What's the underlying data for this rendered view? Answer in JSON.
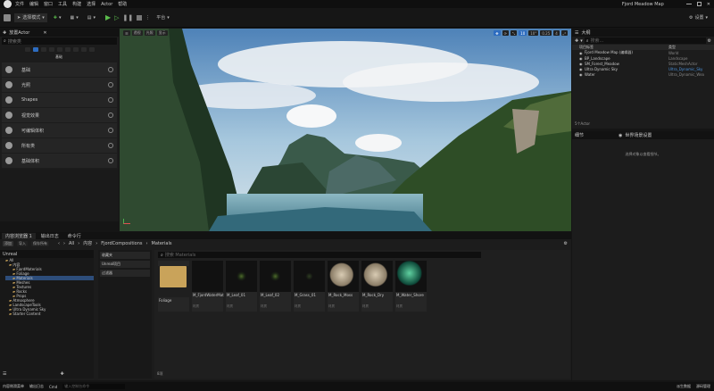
{
  "window": {
    "menu": [
      "文件",
      "编辑",
      "窗口",
      "工具",
      "构建",
      "选择",
      "Actor",
      "帮助"
    ],
    "project": "Fjord Meadow Map",
    "tab": "LostVille"
  },
  "toolbar": {
    "mode": "选择模式",
    "platforms": "平台",
    "settings": "设置"
  },
  "place": {
    "title": "放置Actor",
    "search": "搜索类",
    "items": [
      "基础",
      "光照",
      "Shapes",
      "视觉效果",
      "可编辑体积",
      "所有类",
      "基础体积"
    ]
  },
  "viewport": {
    "left": [
      "透视",
      "光照",
      "显示"
    ],
    "right": [
      "10",
      "10°",
      "0.25",
      "4"
    ]
  },
  "outliner": {
    "title": "大纲",
    "search": "搜索...",
    "col1": "项目标签",
    "col2": "类型",
    "rows": [
      {
        "label": "Fjord Meadow Map (编辑器)",
        "type": "World"
      },
      {
        "label": "BP_Landscape",
        "type": "Landscape"
      },
      {
        "label": "SM_Forest_Meadow",
        "type": "StaticMeshActor"
      },
      {
        "label": "Ultra Dynamic Sky",
        "type": "Ultra_Dynamic_Sky"
      },
      {
        "label": "Water",
        "type": "Ultra_Dynamic_Wea"
      }
    ],
    "count": "5个Actor"
  },
  "details": {
    "tab1": "细节",
    "tab2": "世界场景设置",
    "empty": "选择对象以查看细节。"
  },
  "bottom_tabs": [
    "内容浏览器 1",
    "输出日志",
    "命令行"
  ],
  "content": {
    "buttons": [
      "添加",
      "导入",
      "保存所有"
    ],
    "path": [
      "All",
      "内容",
      "FjordCompositions",
      "Materials"
    ],
    "search": "搜索 Materials",
    "tree_root": "Unreal",
    "tree": [
      "All",
      "内容",
      "FjordMaterials",
      "Foliage",
      "Materials",
      "Meshes",
      "Textures",
      "Rocks",
      "Props",
      "Atmosphere",
      "LandscapeTools",
      "Ultra Dynamic Sky",
      "Starter Content"
    ],
    "filters": [
      "收藏夹",
      "Unreal项目",
      "过滤器"
    ],
    "assets": [
      {
        "name": "Foliage",
        "type": ""
      },
      {
        "name": "M_FjordWaterMat",
        "type": "材质"
      },
      {
        "name": "M_Leaf_01",
        "type": "材质"
      },
      {
        "name": "M_Leaf_02",
        "type": "材质"
      },
      {
        "name": "M_Grass_01",
        "type": "材质"
      },
      {
        "name": "M_Rock_Moss",
        "type": "材质"
      },
      {
        "name": "M_Rock_Dry",
        "type": "材质"
      },
      {
        "name": "M_Water_Shore",
        "type": "材质"
      }
    ],
    "status": "8项"
  },
  "statusbar": {
    "left": [
      "内容侧滑菜单",
      "输出日志",
      "Cmd"
    ],
    "input": "输入控制台命令",
    "right": [
      "派生数据",
      "源码管理"
    ]
  }
}
